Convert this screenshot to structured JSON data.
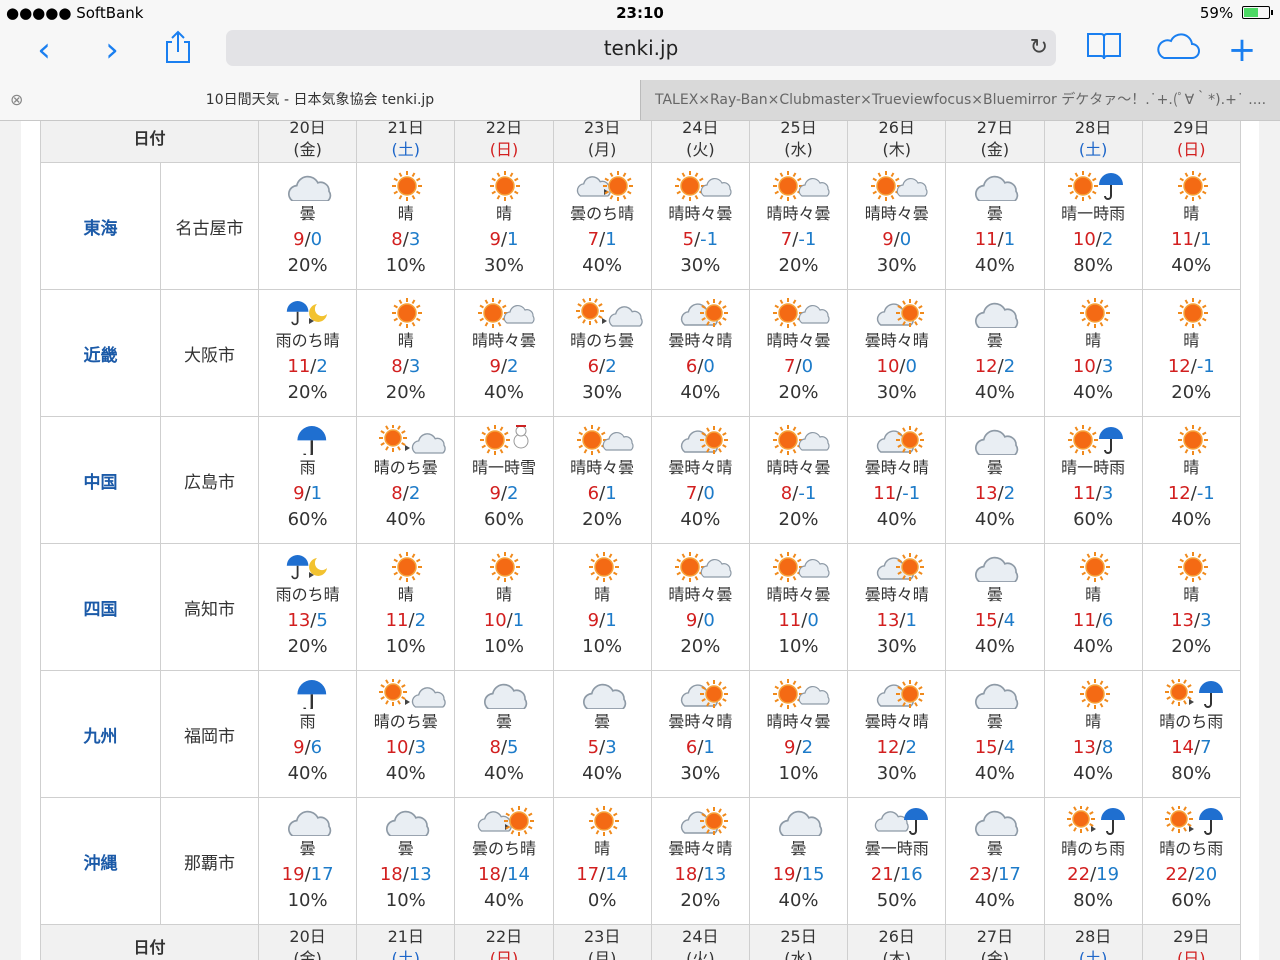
{
  "status": {
    "carrier": "●●●●● SoftBank",
    "time": "23:10",
    "battery": "59%",
    "battery_level": 0.59
  },
  "browser": {
    "url": "tenki.jp"
  },
  "tabs": [
    {
      "title": "10日間天気 - 日本気象協会 tenki.jp"
    },
    {
      "title": "TALEX×Ray-Ban×Clubmaster×Trueviewfocus×Bluemirror デケタァ〜！.˙+.(ﾟ∀｀*).+˙ ...."
    }
  ],
  "table": {
    "date_label": "日付",
    "dates": [
      {
        "d": "20日",
        "w": "(金)",
        "t": "w"
      },
      {
        "d": "21日",
        "w": "(土)",
        "t": "sat"
      },
      {
        "d": "22日",
        "w": "(日)",
        "t": "sun"
      },
      {
        "d": "23日",
        "w": "(月)",
        "t": "w"
      },
      {
        "d": "24日",
        "w": "(火)",
        "t": "w"
      },
      {
        "d": "25日",
        "w": "(水)",
        "t": "w"
      },
      {
        "d": "26日",
        "w": "(木)",
        "t": "w"
      },
      {
        "d": "27日",
        "w": "(金)",
        "t": "w"
      },
      {
        "d": "28日",
        "w": "(土)",
        "t": "sat"
      },
      {
        "d": "29日",
        "w": "(日)",
        "t": "sun"
      }
    ],
    "rows": [
      {
        "region": "東海",
        "city": "名古屋市",
        "days": [
          {
            "icon": "cloud",
            "w": "曇",
            "hi": "9",
            "lo": "0",
            "p": "20%"
          },
          {
            "icon": "sun",
            "w": "晴",
            "hi": "8",
            "lo": "3",
            "p": "10%"
          },
          {
            "icon": "sun",
            "w": "晴",
            "hi": "9",
            "lo": "1",
            "p": "30%"
          },
          {
            "icon": "cloud-to-sun",
            "w": "曇のち晴",
            "hi": "7",
            "lo": "1",
            "p": "40%"
          },
          {
            "icon": "sun-cloud",
            "w": "晴時々曇",
            "hi": "5",
            "lo": "-1",
            "p": "30%"
          },
          {
            "icon": "sun-cloud",
            "w": "晴時々曇",
            "hi": "7",
            "lo": "-1",
            "p": "20%"
          },
          {
            "icon": "sun-cloud",
            "w": "晴時々曇",
            "hi": "9",
            "lo": "0",
            "p": "30%"
          },
          {
            "icon": "cloud",
            "w": "曇",
            "hi": "11",
            "lo": "1",
            "p": "40%"
          },
          {
            "icon": "sun-rain",
            "w": "晴一時雨",
            "hi": "10",
            "lo": "2",
            "p": "80%"
          },
          {
            "icon": "sun",
            "w": "晴",
            "hi": "11",
            "lo": "1",
            "p": "40%"
          }
        ]
      },
      {
        "region": "近畿",
        "city": "大阪市",
        "days": [
          {
            "icon": "rain-to-moon",
            "w": "雨のち晴",
            "hi": "11",
            "lo": "2",
            "p": "20%"
          },
          {
            "icon": "sun",
            "w": "晴",
            "hi": "8",
            "lo": "3",
            "p": "20%"
          },
          {
            "icon": "sun-cloud",
            "w": "晴時々曇",
            "hi": "9",
            "lo": "2",
            "p": "40%"
          },
          {
            "icon": "sun-to-cloud",
            "w": "晴のち曇",
            "hi": "6",
            "lo": "2",
            "p": "30%"
          },
          {
            "icon": "cloud-sun",
            "w": "曇時々晴",
            "hi": "6",
            "lo": "0",
            "p": "40%"
          },
          {
            "icon": "sun-cloud",
            "w": "晴時々曇",
            "hi": "7",
            "lo": "0",
            "p": "20%"
          },
          {
            "icon": "cloud-sun",
            "w": "曇時々晴",
            "hi": "10",
            "lo": "0",
            "p": "30%"
          },
          {
            "icon": "cloud",
            "w": "曇",
            "hi": "12",
            "lo": "2",
            "p": "40%"
          },
          {
            "icon": "sun",
            "w": "晴",
            "hi": "10",
            "lo": "3",
            "p": "40%"
          },
          {
            "icon": "sun",
            "w": "晴",
            "hi": "12",
            "lo": "-1",
            "p": "20%"
          }
        ]
      },
      {
        "region": "中国",
        "city": "広島市",
        "days": [
          {
            "icon": "umbrella",
            "w": "雨",
            "hi": "9",
            "lo": "1",
            "p": "60%"
          },
          {
            "icon": "sun-to-cloud",
            "w": "晴のち曇",
            "hi": "8",
            "lo": "2",
            "p": "40%"
          },
          {
            "icon": "sun-snow",
            "w": "晴一時雪",
            "hi": "9",
            "lo": "2",
            "p": "60%"
          },
          {
            "icon": "sun-cloud",
            "w": "晴時々曇",
            "hi": "6",
            "lo": "1",
            "p": "20%"
          },
          {
            "icon": "cloud-sun",
            "w": "曇時々晴",
            "hi": "7",
            "lo": "0",
            "p": "40%"
          },
          {
            "icon": "sun-cloud",
            "w": "晴時々曇",
            "hi": "8",
            "lo": "-1",
            "p": "20%"
          },
          {
            "icon": "cloud-sun",
            "w": "曇時々晴",
            "hi": "11",
            "lo": "-1",
            "p": "40%"
          },
          {
            "icon": "cloud",
            "w": "曇",
            "hi": "13",
            "lo": "2",
            "p": "40%"
          },
          {
            "icon": "sun-rain",
            "w": "晴一時雨",
            "hi": "11",
            "lo": "3",
            "p": "60%"
          },
          {
            "icon": "sun",
            "w": "晴",
            "hi": "12",
            "lo": "-1",
            "p": "40%"
          }
        ]
      },
      {
        "region": "四国",
        "city": "高知市",
        "days": [
          {
            "icon": "rain-to-moon",
            "w": "雨のち晴",
            "hi": "13",
            "lo": "5",
            "p": "20%"
          },
          {
            "icon": "sun",
            "w": "晴",
            "hi": "11",
            "lo": "2",
            "p": "10%"
          },
          {
            "icon": "sun",
            "w": "晴",
            "hi": "10",
            "lo": "1",
            "p": "10%"
          },
          {
            "icon": "sun",
            "w": "晴",
            "hi": "9",
            "lo": "1",
            "p": "10%"
          },
          {
            "icon": "sun-cloud",
            "w": "晴時々曇",
            "hi": "9",
            "lo": "0",
            "p": "20%"
          },
          {
            "icon": "sun-cloud",
            "w": "晴時々曇",
            "hi": "11",
            "lo": "0",
            "p": "10%"
          },
          {
            "icon": "cloud-sun",
            "w": "曇時々晴",
            "hi": "13",
            "lo": "1",
            "p": "30%"
          },
          {
            "icon": "cloud",
            "w": "曇",
            "hi": "15",
            "lo": "4",
            "p": "40%"
          },
          {
            "icon": "sun",
            "w": "晴",
            "hi": "11",
            "lo": "6",
            "p": "40%"
          },
          {
            "icon": "sun",
            "w": "晴",
            "hi": "13",
            "lo": "3",
            "p": "20%"
          }
        ]
      },
      {
        "region": "九州",
        "city": "福岡市",
        "days": [
          {
            "icon": "umbrella",
            "w": "雨",
            "hi": "9",
            "lo": "6",
            "p": "40%"
          },
          {
            "icon": "sun-to-cloud",
            "w": "晴のち曇",
            "hi": "10",
            "lo": "3",
            "p": "40%"
          },
          {
            "icon": "cloud",
            "w": "曇",
            "hi": "8",
            "lo": "5",
            "p": "40%"
          },
          {
            "icon": "cloud",
            "w": "曇",
            "hi": "5",
            "lo": "3",
            "p": "40%"
          },
          {
            "icon": "cloud-sun",
            "w": "曇時々晴",
            "hi": "6",
            "lo": "1",
            "p": "30%"
          },
          {
            "icon": "sun-cloud",
            "w": "晴時々曇",
            "hi": "9",
            "lo": "2",
            "p": "10%"
          },
          {
            "icon": "cloud-sun",
            "w": "曇時々晴",
            "hi": "12",
            "lo": "2",
            "p": "30%"
          },
          {
            "icon": "cloud",
            "w": "曇",
            "hi": "15",
            "lo": "4",
            "p": "40%"
          },
          {
            "icon": "sun",
            "w": "晴",
            "hi": "13",
            "lo": "8",
            "p": "40%"
          },
          {
            "icon": "sun-to-rain",
            "w": "晴のち雨",
            "hi": "14",
            "lo": "7",
            "p": "80%"
          }
        ]
      },
      {
        "region": "沖縄",
        "city": "那覇市",
        "days": [
          {
            "icon": "cloud",
            "w": "曇",
            "hi": "19",
            "lo": "17",
            "p": "10%"
          },
          {
            "icon": "cloud",
            "w": "曇",
            "hi": "18",
            "lo": "13",
            "p": "10%"
          },
          {
            "icon": "cloud-to-sun",
            "w": "曇のち晴",
            "hi": "18",
            "lo": "14",
            "p": "40%"
          },
          {
            "icon": "sun",
            "w": "晴",
            "hi": "17",
            "lo": "14",
            "p": "0%"
          },
          {
            "icon": "cloud-sun",
            "w": "曇時々晴",
            "hi": "18",
            "lo": "13",
            "p": "20%"
          },
          {
            "icon": "cloud",
            "w": "曇",
            "hi": "19",
            "lo": "15",
            "p": "40%"
          },
          {
            "icon": "cloud-rain",
            "w": "曇一時雨",
            "hi": "21",
            "lo": "16",
            "p": "50%"
          },
          {
            "icon": "cloud",
            "w": "曇",
            "hi": "23",
            "lo": "17",
            "p": "40%"
          },
          {
            "icon": "sun-to-rain",
            "w": "晴のち雨",
            "hi": "22",
            "lo": "19",
            "p": "80%"
          },
          {
            "icon": "sun-to-rain",
            "w": "晴のち雨",
            "hi": "22",
            "lo": "20",
            "p": "60%"
          }
        ]
      }
    ]
  }
}
